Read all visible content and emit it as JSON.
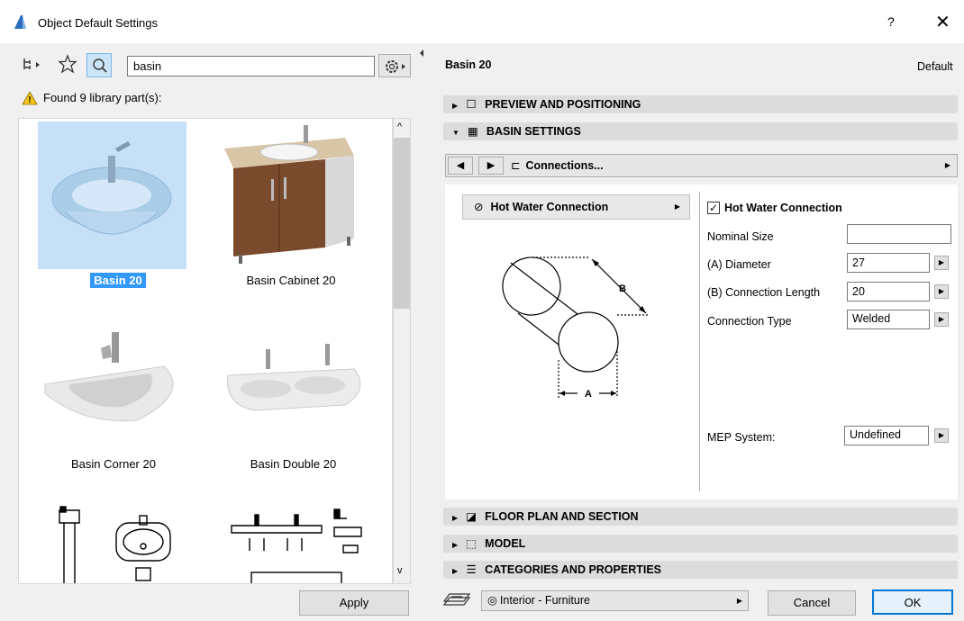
{
  "window": {
    "title": "Object Default Settings",
    "help": "?",
    "close": "✕"
  },
  "search": {
    "value": "basin"
  },
  "status": {
    "found": "Found 9 library part(s):"
  },
  "library": {
    "items": [
      {
        "label": "Basin 20",
        "selected": true
      },
      {
        "label": "Basin Cabinet 20"
      },
      {
        "label": "Basin Corner 20"
      },
      {
        "label": "Basin Double 20"
      }
    ]
  },
  "apply_label": "Apply",
  "header": {
    "part_name": "Basin 20",
    "default_label": "Default"
  },
  "sections": {
    "preview": "PREVIEW AND POSITIONING",
    "basin_settings": "BASIN SETTINGS",
    "floor_plan": "FLOOR PLAN AND SECTION",
    "model": "MODEL",
    "categories": "CATEGORIES AND PROPERTIES"
  },
  "page_nav": {
    "page_label": "Connections..."
  },
  "connection": {
    "dropdown_label": "Hot Water Connection",
    "checkbox_label": "Hot Water Connection",
    "checked": true,
    "nominal_size_label": "Nominal Size",
    "nominal_size_value": "",
    "diameter_label": "(A) Diameter",
    "diameter_value": "27",
    "length_label": "(B) Connection Length",
    "length_value": "20",
    "type_label": "Connection Type",
    "type_value": "Welded",
    "mep_label": "MEP System:",
    "mep_value": "Undefined",
    "diagram_a": "A",
    "diagram_b": "B"
  },
  "footer": {
    "layer": "Interior - Furniture",
    "cancel": "Cancel",
    "ok": "OK"
  }
}
